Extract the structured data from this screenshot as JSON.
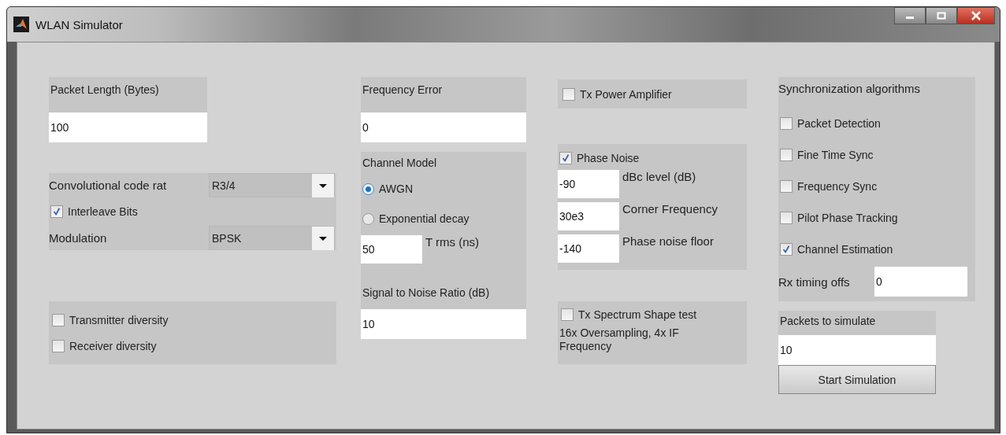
{
  "window": {
    "title": "WLAN Simulator"
  },
  "packet_length": {
    "label": "Packet Length (Bytes)",
    "value": "100"
  },
  "coding": {
    "code_rate": {
      "label": "Convolutional code rat",
      "value": "R3/4"
    },
    "interleave": {
      "label": "Interleave Bits",
      "checked": true
    },
    "modulation": {
      "label": "Modulation",
      "value": "BPSK"
    }
  },
  "diversity": [
    {
      "label": "Transmitter diversity",
      "checked": false
    },
    {
      "label": "Receiver diversity",
      "checked": false
    }
  ],
  "frequency_error": {
    "label": "Frequency Error",
    "value": "0"
  },
  "channel_model": {
    "label": "Channel Model",
    "options": [
      {
        "label": "AWGN",
        "selected": true
      },
      {
        "label": "Exponential decay",
        "selected": false
      }
    ],
    "trms": {
      "value": "50",
      "label": "T rms (ns)"
    }
  },
  "snr": {
    "label": "Signal to Noise Ratio (dB)",
    "value": "10"
  },
  "tx_power_amplifier": {
    "label": "Tx Power Amplifier",
    "checked": false
  },
  "phase_noise": {
    "label": "Phase Noise",
    "checked": true,
    "params": [
      {
        "value": "-90",
        "label": "dBc level (dB)"
      },
      {
        "value": "30e3",
        "label": "Corner Frequency"
      },
      {
        "value": "-140",
        "label": "Phase noise floor"
      }
    ]
  },
  "tx_spectrum": {
    "label": "Tx Spectrum Shape test",
    "checked": false,
    "note": "16x Oversampling, 4x IF Frequency"
  },
  "sync": {
    "title": "Synchronization algorithms",
    "options": [
      {
        "label": "Packet Detection",
        "checked": false
      },
      {
        "label": "Fine Time Sync",
        "checked": false
      },
      {
        "label": "Frequency Sync",
        "checked": false
      },
      {
        "label": "Pilot Phase Tracking",
        "checked": false
      },
      {
        "label": "Channel Estimation",
        "checked": true
      }
    ],
    "rx_timing": {
      "label": "Rx timing offs",
      "value": "0"
    }
  },
  "packets": {
    "label": "Packets to simulate",
    "value": "10"
  },
  "start_button": "Start Simulation"
}
